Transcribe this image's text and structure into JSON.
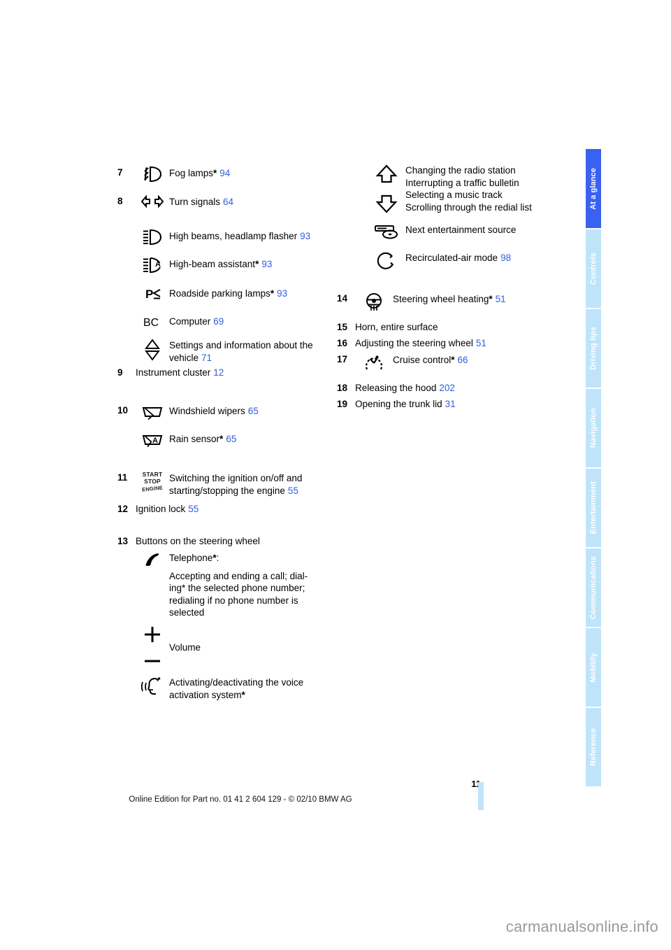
{
  "document": {
    "page_number": "11",
    "footer_note": "Online Edition for Part no. 01 41 2 604 129 - © 02/10 BMW AG",
    "watermark": "carmanualsonline.info"
  },
  "colors": {
    "active_tab": "#3a62f0",
    "inactive_tab": "#bfe4fa",
    "page_reference": "#2f5fe0",
    "text": "#000000"
  },
  "tabs": [
    {
      "label": "At a glance",
      "active": true
    },
    {
      "label": "Controls",
      "active": false
    },
    {
      "label": "Driving tips",
      "active": false
    },
    {
      "label": "Navigation",
      "active": false
    },
    {
      "label": "Entertainment",
      "active": false
    },
    {
      "label": "Communications",
      "active": false
    },
    {
      "label": "Mobility",
      "active": false
    },
    {
      "label": "Reference",
      "active": false
    }
  ],
  "left_column": [
    {
      "number": "7",
      "icon": "fog-lamp-icon",
      "label": "Fog lamps",
      "asterisk": true,
      "page": "94"
    },
    {
      "number": "8",
      "icon": "turn-signal-icon",
      "label": "Turn signals",
      "asterisk": false,
      "page": "64"
    },
    {
      "number": "",
      "icon": "high-beam-icon",
      "label": "High beams, headlamp flasher",
      "asterisk": false,
      "page": "93"
    },
    {
      "number": "",
      "icon": "high-beam-assistant-icon",
      "label": "High-beam assistant",
      "asterisk": true,
      "page": "93"
    },
    {
      "number": "",
      "icon": "roadside-parking-lamp-icon",
      "label": "Roadside parking lamps",
      "asterisk": true,
      "page": "93"
    },
    {
      "number": "",
      "icon": "bc-computer-icon",
      "label": "Computer",
      "asterisk": false,
      "page": "69"
    },
    {
      "number": "",
      "icon": "up-down-triangle-icon",
      "label_line1": "Settings and information about the",
      "label_line2": "vehicle",
      "asterisk": false,
      "page": "71"
    },
    {
      "number": "9",
      "icon": null,
      "label": "Instrument cluster",
      "asterisk": false,
      "page": "12"
    },
    {
      "number": "10",
      "icon": "windshield-wiper-icon",
      "label": "Windshield wipers",
      "asterisk": false,
      "page": "65"
    },
    {
      "number": "",
      "icon": "rain-sensor-icon",
      "label": "Rain sensor",
      "asterisk": true,
      "page": "65"
    },
    {
      "number": "11",
      "icon": "start-stop-engine-icon",
      "label_line1": "Switching the ignition on/off and",
      "label_line2": "starting/stopping the engine",
      "asterisk": false,
      "page": "55"
    },
    {
      "number": "12",
      "icon": null,
      "label": "Ignition lock",
      "asterisk": false,
      "page": "55"
    },
    {
      "number": "13",
      "icon": null,
      "label": "Buttons on the steering wheel",
      "asterisk": false,
      "page": ""
    },
    {
      "number": "",
      "icon": "telephone-handset-icon",
      "label_heading": "Telephone",
      "heading_asterisk": true,
      "heading_suffix": ":",
      "body_lines": [
        "Accepting and ending a call; dial-",
        "ing* the selected phone number;",
        "redialing if no phone number is",
        "selected"
      ]
    },
    {
      "number": "",
      "icon": "plus-minus-volume-icon",
      "label": "Volume",
      "asterisk": false,
      "page": ""
    },
    {
      "number": "",
      "icon": "voice-activation-icon",
      "label_line1": "Activating/deactivating the voice",
      "label_line2": "activation system",
      "asterisk": true,
      "page": ""
    }
  ],
  "right_column": [
    {
      "number": "",
      "icon": "up-down-arrow-icon",
      "lines": [
        "Changing the radio station",
        "Interrupting a traffic bulletin",
        "Selecting a music track",
        "Scrolling through the redial list"
      ]
    },
    {
      "number": "",
      "icon": "entertainment-source-icon",
      "label": "Next entertainment source",
      "asterisk": false,
      "page": ""
    },
    {
      "number": "",
      "icon": "recirculated-air-icon",
      "label": "Recirculated-air mode",
      "asterisk": false,
      "page": "98"
    },
    {
      "number": "14",
      "icon": "steering-wheel-heating-icon",
      "label": "Steering wheel heating",
      "asterisk": true,
      "page": "51"
    },
    {
      "number": "15",
      "icon": null,
      "label": "Horn, entire surface",
      "asterisk": false,
      "page": ""
    },
    {
      "number": "16",
      "icon": null,
      "label": "Adjusting the steering wheel",
      "asterisk": false,
      "page": "51"
    },
    {
      "number": "17",
      "icon": "cruise-control-icon",
      "label": "Cruise control",
      "asterisk": true,
      "page": "66"
    },
    {
      "number": "18",
      "icon": null,
      "label": "Releasing the hood",
      "asterisk": false,
      "page": "202"
    },
    {
      "number": "19",
      "icon": null,
      "label": "Opening the trunk lid",
      "asterisk": false,
      "page": "31"
    }
  ]
}
